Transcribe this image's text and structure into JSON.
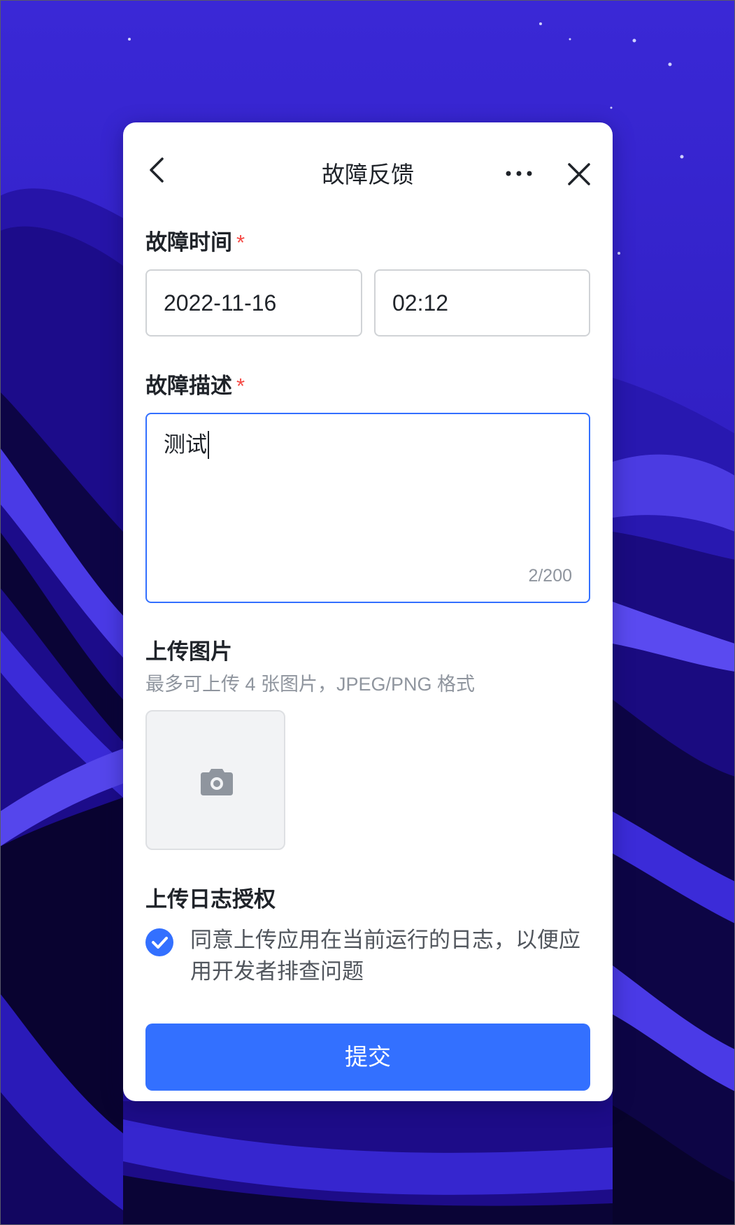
{
  "dialog": {
    "title": "故障反馈",
    "icons": {
      "back": "chevron-left-icon",
      "more": "more-horizontal-icon",
      "close": "close-icon"
    }
  },
  "fault_time": {
    "label": "故障时间",
    "required_mark": "*",
    "date_value": "2022-11-16",
    "time_value": "02:12"
  },
  "fault_description": {
    "label": "故障描述",
    "required_mark": "*",
    "value": "测试",
    "char_count": "2/200"
  },
  "upload_images": {
    "label": "上传图片",
    "hint": "最多可上传 4 张图片，JPEG/PNG 格式",
    "icon": "camera-icon"
  },
  "log_authorization": {
    "label": "上传日志授权",
    "checked": true,
    "consent_text": "同意上传应用在当前运行的日志，以便应用开发者排查问题"
  },
  "submit": {
    "label": "提交"
  },
  "colors": {
    "accent": "#3370ff",
    "required": "#f54a45",
    "background": "#2f1fc7"
  }
}
